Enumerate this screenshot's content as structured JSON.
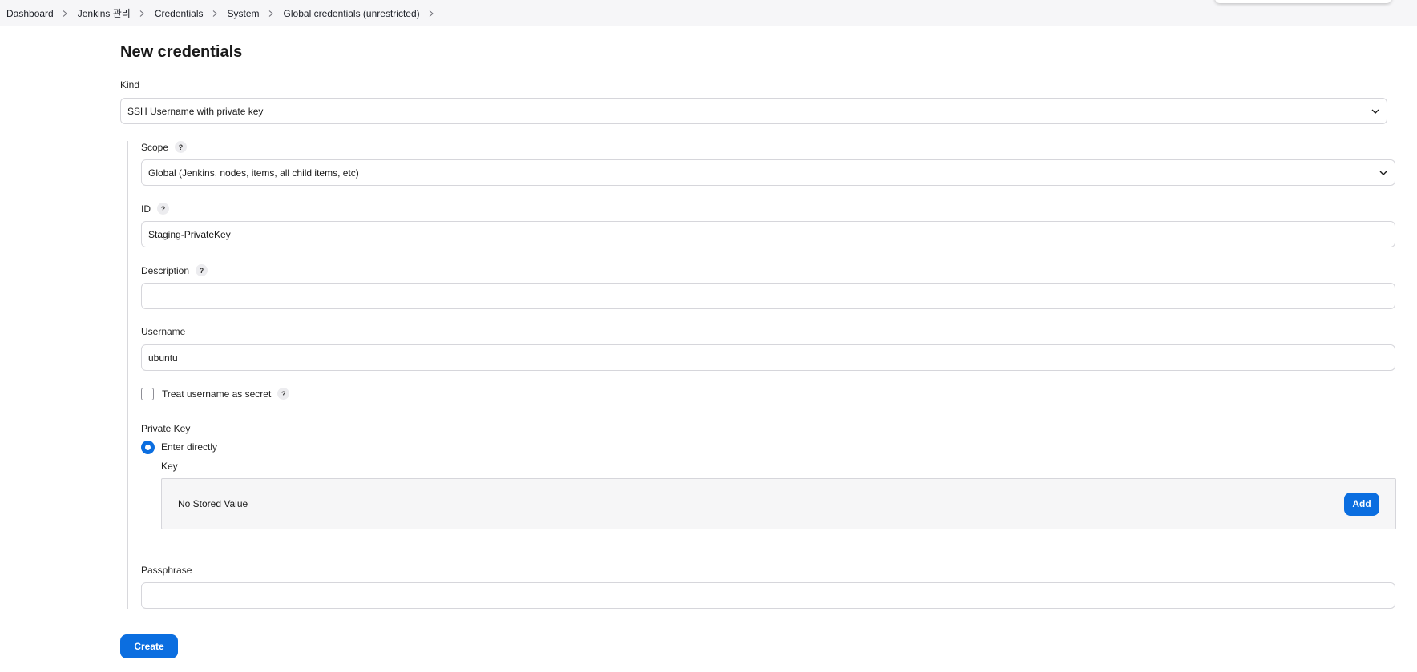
{
  "breadcrumb": [
    {
      "label": "Dashboard"
    },
    {
      "label": "Jenkins 관리"
    },
    {
      "label": "Credentials"
    },
    {
      "label": "System"
    },
    {
      "label": "Global credentials (unrestricted)"
    }
  ],
  "page_title": "New credentials",
  "kind": {
    "label": "Kind",
    "value": "SSH Username with private key"
  },
  "scope": {
    "label": "Scope",
    "value": "Global (Jenkins, nodes, items, all child items, etc)"
  },
  "id_field": {
    "label": "ID",
    "value": "Staging-PrivateKey"
  },
  "description": {
    "label": "Description",
    "value": ""
  },
  "username": {
    "label": "Username",
    "value": "ubuntu"
  },
  "treat_secret": {
    "label": "Treat username as secret",
    "checked": false
  },
  "private_key": {
    "label": "Private Key",
    "option_label": "Enter directly",
    "selected": true,
    "key_label": "Key",
    "key_status": "No Stored Value",
    "add_label": "Add"
  },
  "passphrase": {
    "label": "Passphrase",
    "value": ""
  },
  "help_glyph": "?",
  "create_label": "Create",
  "colors": {
    "accent": "#0b6ee0",
    "breadcrumb_bg": "#f6f6f8"
  },
  "icons": [
    "chevron-right-icon",
    "chevron-down-icon",
    "help-icon"
  ]
}
